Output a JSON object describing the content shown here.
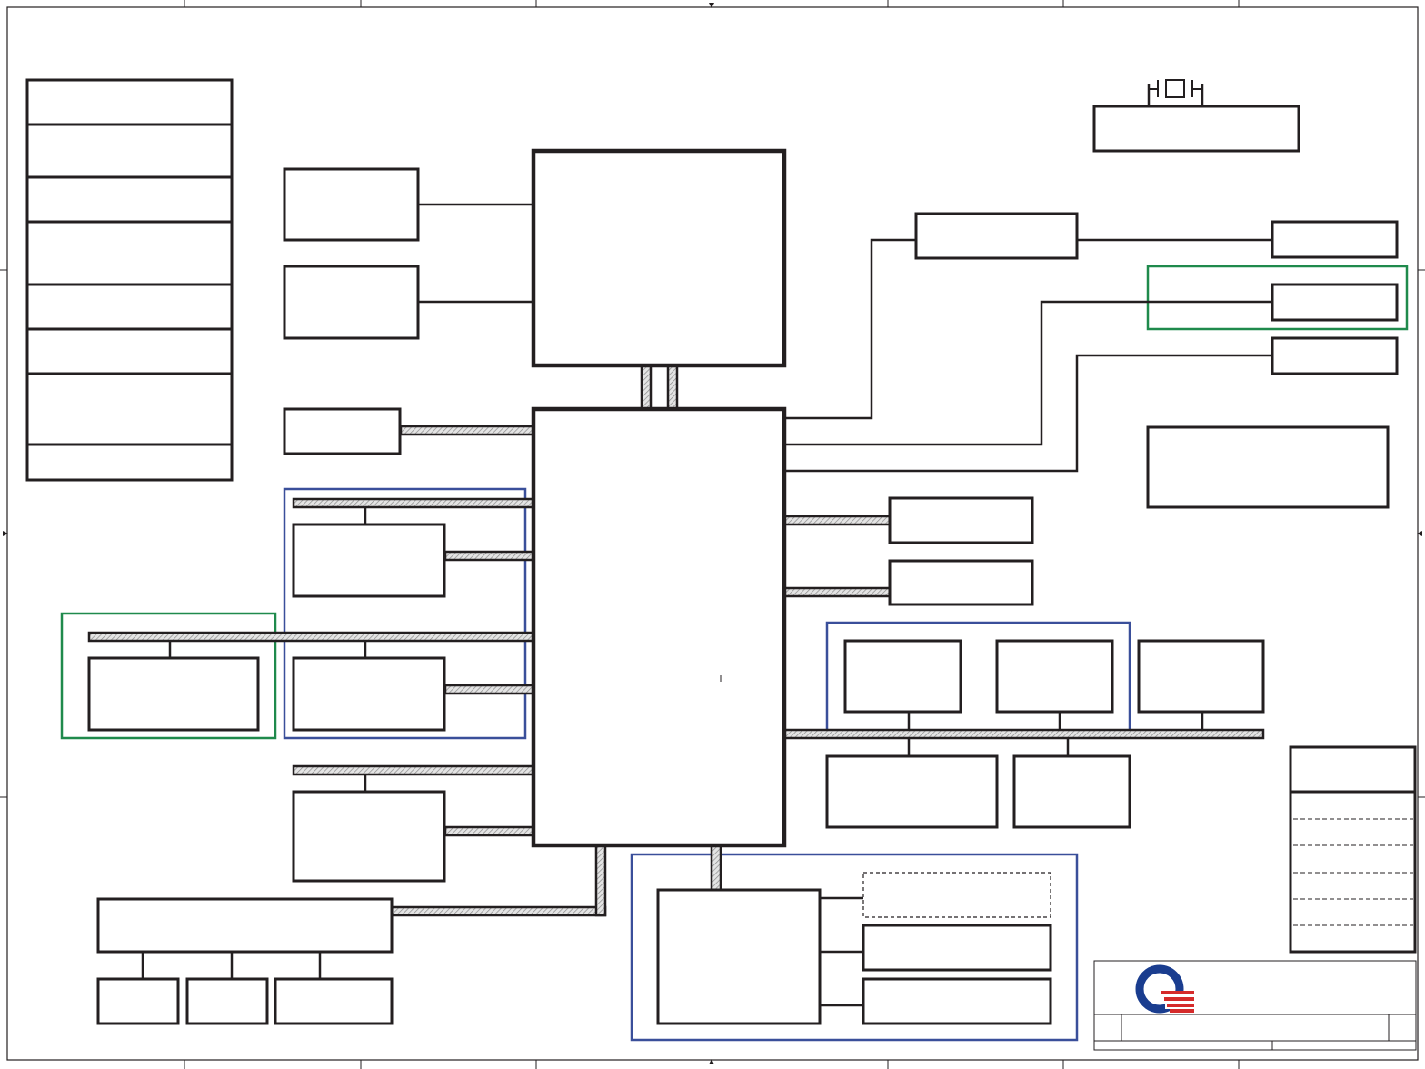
{
  "colors": {
    "ink": "#231f20",
    "bus_fill": "#d6d6d6",
    "group_green": "#1f8a4c",
    "group_blue": "#3a4f9a",
    "logo_blue": "#1a3d8f",
    "logo_red": "#d52b2b"
  },
  "text": {},
  "icons": [
    "crystal-oscillator-icon",
    "company-logo-icon"
  ]
}
